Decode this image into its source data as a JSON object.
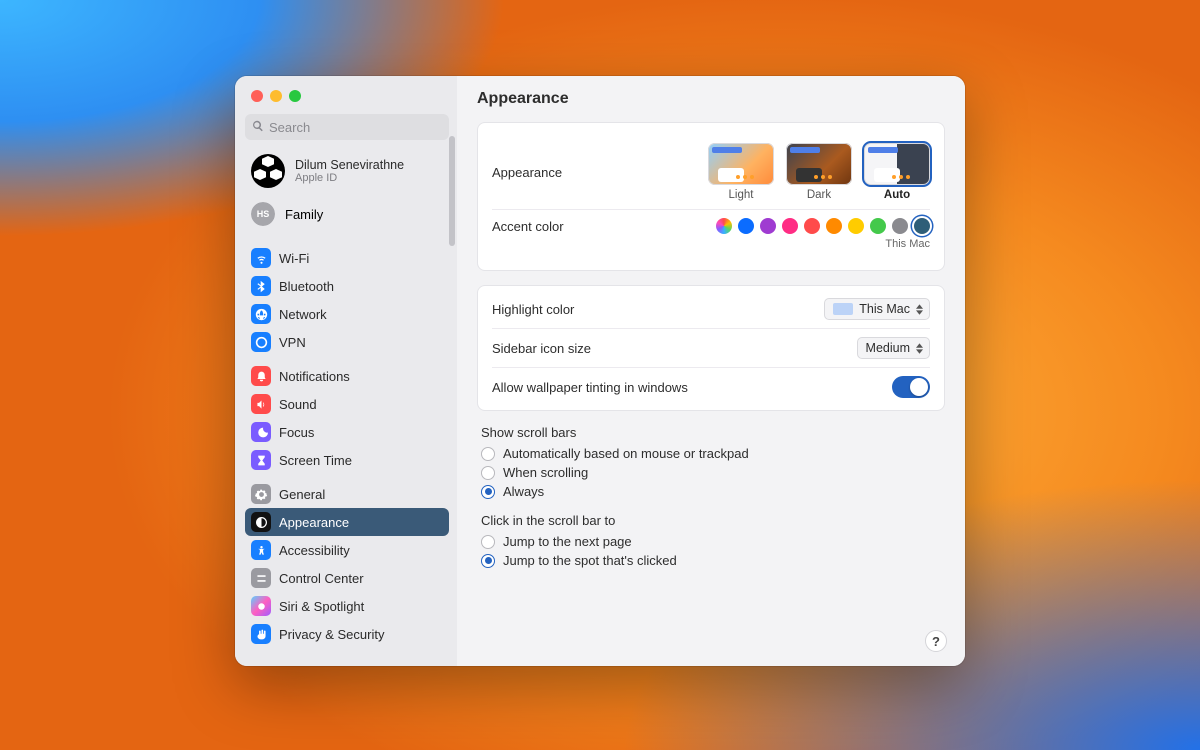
{
  "search": {
    "placeholder": "Search"
  },
  "account": {
    "name": "Dilum Senevirathne",
    "sub": "Apple ID"
  },
  "family": {
    "label": "Family",
    "badge": "HS"
  },
  "sidebar": {
    "group1": [
      {
        "label": "Wi-Fi",
        "color": "#187fff"
      },
      {
        "label": "Bluetooth",
        "color": "#187fff"
      },
      {
        "label": "Network",
        "color": "#187fff"
      },
      {
        "label": "VPN",
        "color": "#187fff"
      }
    ],
    "group2": [
      {
        "label": "Notifications",
        "color": "#ff4b4b"
      },
      {
        "label": "Sound",
        "color": "#ff4b4b"
      },
      {
        "label": "Focus",
        "color": "#7a5cff"
      },
      {
        "label": "Screen Time",
        "color": "#7a5cff"
      }
    ],
    "group3": [
      {
        "label": "General",
        "color": "#9a9aa0"
      },
      {
        "label": "Appearance",
        "color": "#111"
      },
      {
        "label": "Accessibility",
        "color": "#187fff"
      },
      {
        "label": "Control Center",
        "color": "#9a9aa0"
      },
      {
        "label": "Siri & Spotlight",
        "color": "#3a3a3e"
      },
      {
        "label": "Privacy & Security",
        "color": "#187fff"
      }
    ],
    "selected": "Appearance"
  },
  "page": {
    "title": "Appearance",
    "appearance": {
      "label": "Appearance",
      "options": [
        "Light",
        "Dark",
        "Auto"
      ],
      "selected": "Auto"
    },
    "accent": {
      "label": "Accent color",
      "colors": [
        "multi",
        "#0b6cff",
        "#9f3bd1",
        "#ff2d84",
        "#ff4b4b",
        "#ff8a00",
        "#ffcc00",
        "#44c94b",
        "#8a8a8f",
        "#2f5e78"
      ],
      "selected_index": 9,
      "caption": "This Mac"
    },
    "highlight": {
      "label": "Highlight color",
      "value": "This Mac"
    },
    "sidebar_icon": {
      "label": "Sidebar icon size",
      "value": "Medium"
    },
    "tinting": {
      "label": "Allow wallpaper tinting in windows",
      "on": true
    },
    "scrollbars": {
      "label": "Show scroll bars",
      "options": [
        "Automatically based on mouse or trackpad",
        "When scrolling",
        "Always"
      ],
      "selected_index": 2
    },
    "click_scroll": {
      "label": "Click in the scroll bar to",
      "options": [
        "Jump to the next page",
        "Jump to the spot that's clicked"
      ],
      "selected_index": 1
    }
  },
  "help_glyph": "?"
}
